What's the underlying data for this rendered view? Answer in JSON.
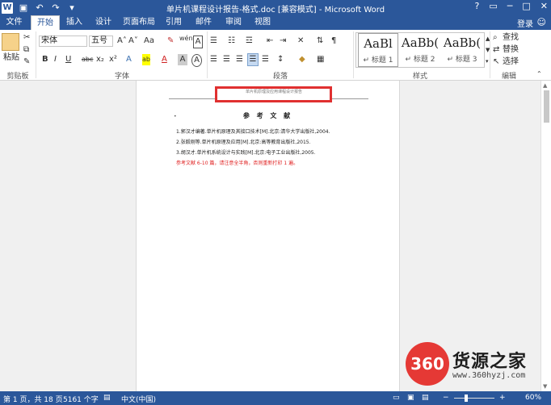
{
  "window": {
    "title": "单片机课程设计报告-格式.doc [兼容模式] - Microsoft Word",
    "controls": [
      "?",
      "▭",
      "─",
      "□",
      "✕"
    ]
  },
  "quick_access": [
    "save-icon",
    "undo-icon",
    "redo-icon",
    "customize-icon"
  ],
  "tabs": [
    {
      "label": "文件"
    },
    {
      "label": "开始"
    },
    {
      "label": "插入"
    },
    {
      "label": "设计"
    },
    {
      "label": "页面布局"
    },
    {
      "label": "引用"
    },
    {
      "label": "邮件"
    },
    {
      "label": "审阅"
    },
    {
      "label": "视图"
    }
  ],
  "account": {
    "login_label": "登录",
    "face": "☺"
  },
  "ribbon": {
    "clipboard": {
      "paste_label": "粘贴",
      "group_label": "剪贴板"
    },
    "font": {
      "font_name": "宋体",
      "font_size": "五号",
      "group_label": "字体",
      "buttons": [
        "A˄",
        "A˅",
        "Aa",
        "✎",
        "wén",
        "A"
      ],
      "format_buttons": [
        "B",
        "I",
        "U",
        "abc",
        "x₂",
        "x²",
        "A",
        "ab",
        "A",
        "A",
        "A"
      ]
    },
    "paragraph": {
      "group_label": "段落"
    },
    "styles": {
      "group_label": "样式",
      "items": [
        {
          "sample": "AaBl",
          "name": "↵ 标题 1"
        },
        {
          "sample": "AaBb(",
          "name": "↵ 标题 2"
        },
        {
          "sample": "AaBb(",
          "name": "↵ 标题 3"
        }
      ]
    },
    "editing": {
      "group_label": "编辑",
      "find_label": "查找",
      "replace_label": "替换",
      "select_label": "选择"
    }
  },
  "document": {
    "header_text": "单片机原理及应用课程设计报告",
    "ref_title": "参 考 文 献",
    "references": [
      "1.郭汉才编著.单片机原理及其接口技术[M].北京:清华大学出版社,2004.",
      "2.张毅刚等.单片机原理及应用[M].北京:高等教育出版社,2015.",
      "3.胡汉才.单片机系统设计与实践[M].北京:电子工业出版社,2005."
    ],
    "note": "参考文献 6-10 篇，请注意全半角，否则重新打印 1 遍。"
  },
  "status": {
    "page": "第 1 页，共 18 页",
    "words": "5161 个字",
    "language": "中文(中国)",
    "zoom": "60%",
    "zoom_level": 0.6
  },
  "watermark": {
    "logo_text": "360",
    "name": "货源之家",
    "url": "www.360hyzj.com"
  }
}
